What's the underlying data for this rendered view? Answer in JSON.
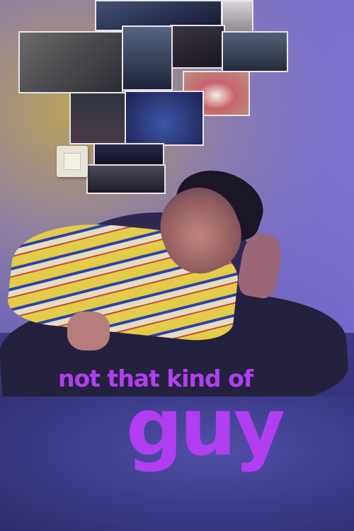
{
  "poster": {
    "title_line1": "not that kind of",
    "title_line2": "guy",
    "title_color": "#b13ef0",
    "photos": [
      {
        "name": "photo-building",
        "bg": "linear-gradient(135deg,#6b6a6a,#2b2c33)"
      },
      {
        "name": "photo-night-sky",
        "bg": "linear-gradient(160deg,#445074,#121830)"
      },
      {
        "name": "photo-dark-scene",
        "bg": "linear-gradient(160deg,#3a3540,#1a1622)"
      },
      {
        "name": "photo-umbrella-figure",
        "bg": "linear-gradient(180deg,#d8d4d8,#8c8890)"
      },
      {
        "name": "photo-mountains",
        "bg": "linear-gradient(180deg,#526078,#262c3a)"
      },
      {
        "name": "photo-smile",
        "bg": "radial-gradient(ellipse at 50% 55%,#f4f0ec 0%,#c8646a 40%,#b89080 100%)"
      },
      {
        "name": "photo-moon",
        "bg": "linear-gradient(180deg,#2e3440,#4a3a48)"
      },
      {
        "name": "photo-blue-abstract",
        "bg": "radial-gradient(circle at 50% 60%,#3d56a8,#1c2050)"
      },
      {
        "name": "photo-landscape",
        "bg": "linear-gradient(180deg,#2c2a4a,#0f0f22)"
      },
      {
        "name": "photo-street",
        "bg": "linear-gradient(180deg,#4b4a58,#1e1c28)"
      }
    ]
  }
}
